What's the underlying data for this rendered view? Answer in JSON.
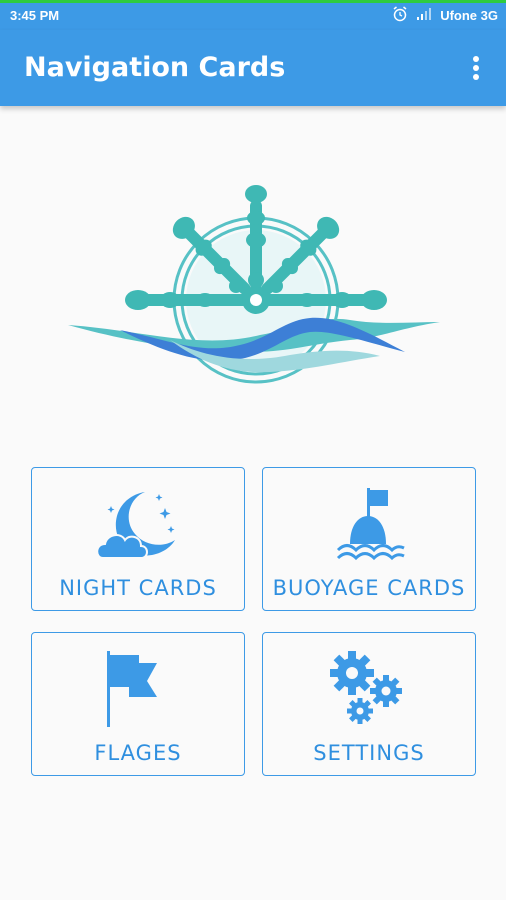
{
  "status_bar": {
    "time": "3:45 PM",
    "carrier": "Ufone 3G",
    "icons": [
      "alarm-icon",
      "signal-icon"
    ]
  },
  "app_bar": {
    "title": "Navigation Cards",
    "menu_icon": "more-vert-icon"
  },
  "colors": {
    "primary": "#3d9ae6",
    "accent_text": "#2f8fdf",
    "logo_teal": "#3fb8b4",
    "background": "#fafafa"
  },
  "cards": [
    {
      "label": "NIGHT CARDS",
      "icon": "moon-cloud-icon"
    },
    {
      "label": "BUOYAGE CARDS",
      "icon": "buoy-icon"
    },
    {
      "label": "FLAGES",
      "icon": "flag-icon"
    },
    {
      "label": "SETTINGS",
      "icon": "gears-icon"
    }
  ]
}
